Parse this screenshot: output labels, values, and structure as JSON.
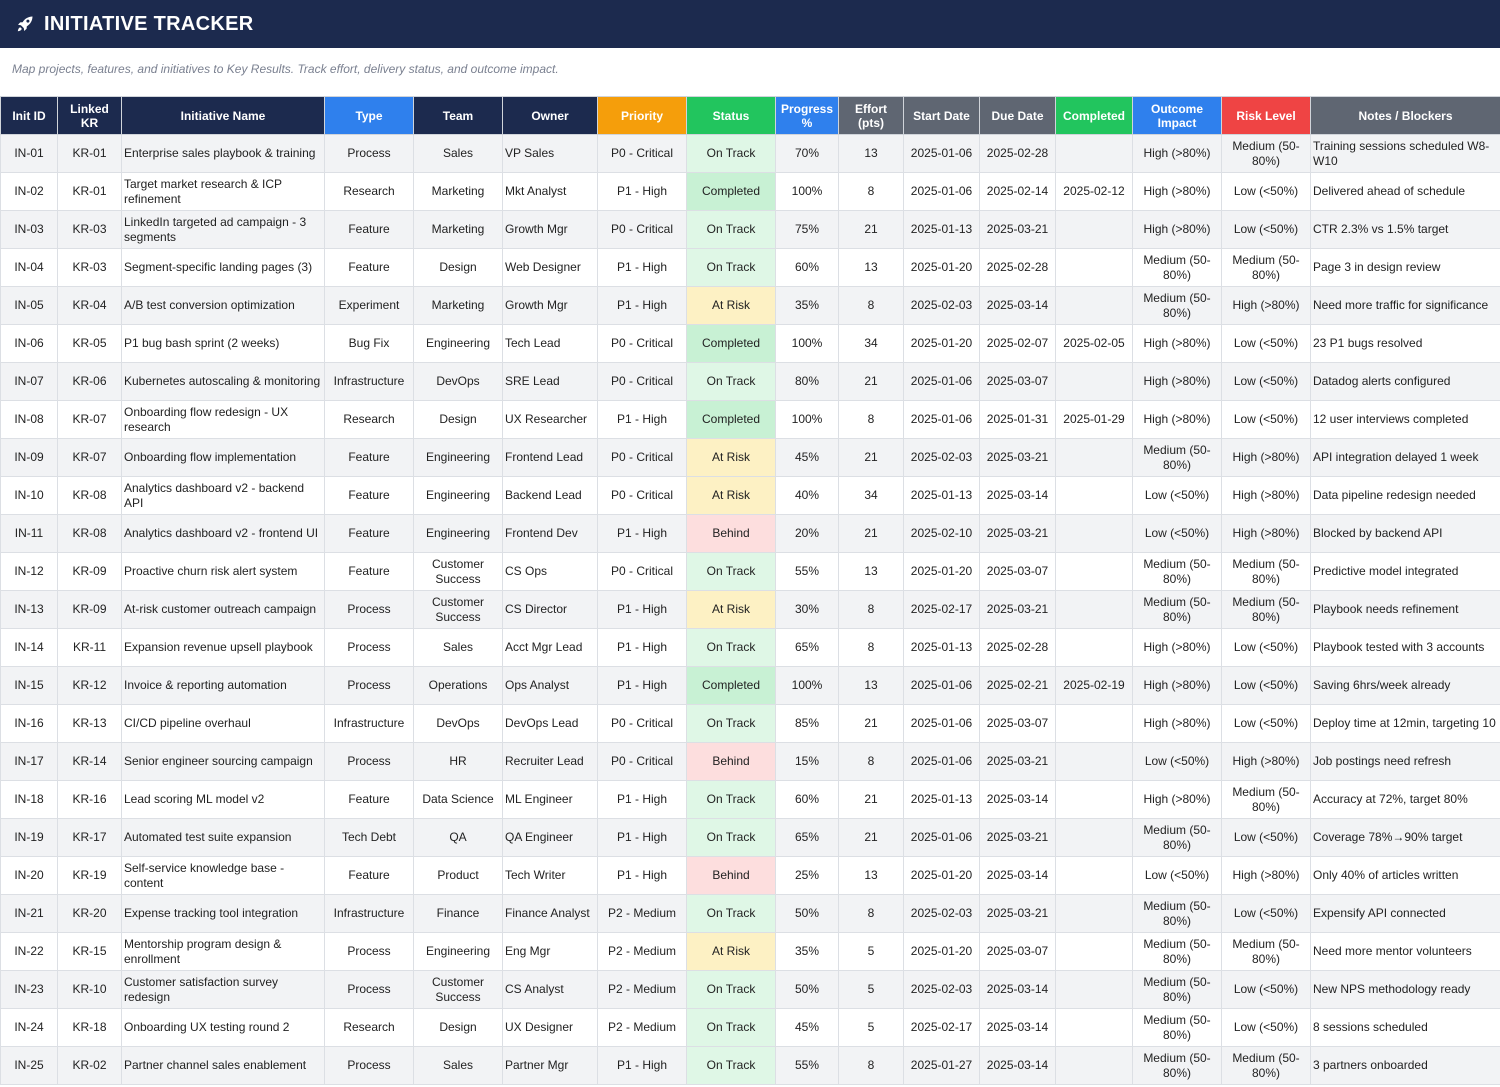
{
  "header": {
    "title": "INITIATIVE TRACKER",
    "icon": "rocket-icon",
    "subtitle": "Map projects, features, and initiatives to Key Results. Track effort, delivery status, and outcome impact."
  },
  "colors": {
    "title_bar": "#1c2a4e",
    "header_dark": "#1c2a4e",
    "header_type": "#2f80ed",
    "header_priority": "#f59e0b",
    "header_status": "#22c55e",
    "header_gray": "#5f6672",
    "header_completed": "#22c55e",
    "header_outcome": "#2f80ed",
    "header_risk": "#ef4444",
    "header_notes": "#5f6672",
    "status_on_track": "#dff7e6",
    "status_completed": "#c8f1d4",
    "status_at_risk": "#fdf1c4",
    "status_behind": "#fddede"
  },
  "columns": [
    {
      "label": "Init ID",
      "color": "#1c2a4e"
    },
    {
      "label": "Linked KR",
      "color": "#1c2a4e"
    },
    {
      "label": "Initiative Name",
      "color": "#1c2a4e"
    },
    {
      "label": "Type",
      "color": "#2f80ed"
    },
    {
      "label": "Team",
      "color": "#1c2a4e"
    },
    {
      "label": "Owner",
      "color": "#1c2a4e"
    },
    {
      "label": "Priority",
      "color": "#f59e0b"
    },
    {
      "label": "Status",
      "color": "#22c55e"
    },
    {
      "label": "Progress %",
      "color": "#2f80ed"
    },
    {
      "label": "Effort (pts)",
      "color": "#5f6672"
    },
    {
      "label": "Start Date",
      "color": "#5f6672"
    },
    {
      "label": "Due Date",
      "color": "#5f6672"
    },
    {
      "label": "Completed",
      "color": "#22c55e"
    },
    {
      "label": "Outcome Impact",
      "color": "#2f80ed"
    },
    {
      "label": "Risk Level",
      "color": "#ef4444"
    },
    {
      "label": "Notes / Blockers",
      "color": "#5f6672"
    }
  ],
  "rows": [
    [
      "IN-01",
      "KR-01",
      "Enterprise sales playbook & training",
      "Process",
      "Sales",
      "VP Sales",
      "P0 - Critical",
      "On Track",
      "70%",
      "13",
      "2025-01-06",
      "2025-02-28",
      "",
      "High (>80%)",
      "Medium (50-80%)",
      "Training sessions scheduled W8-W10"
    ],
    [
      "IN-02",
      "KR-01",
      "Target market research & ICP refinement",
      "Research",
      "Marketing",
      "Mkt Analyst",
      "P1 - High",
      "Completed",
      "100%",
      "8",
      "2025-01-06",
      "2025-02-14",
      "2025-02-12",
      "High (>80%)",
      "Low (<50%)",
      "Delivered ahead of schedule"
    ],
    [
      "IN-03",
      "KR-03",
      "LinkedIn targeted ad campaign - 3 segments",
      "Feature",
      "Marketing",
      "Growth Mgr",
      "P0 - Critical",
      "On Track",
      "75%",
      "21",
      "2025-01-13",
      "2025-03-21",
      "",
      "High (>80%)",
      "Low (<50%)",
      "CTR 2.3% vs 1.5% target"
    ],
    [
      "IN-04",
      "KR-03",
      "Segment-specific landing pages (3)",
      "Feature",
      "Design",
      "Web Designer",
      "P1 - High",
      "On Track",
      "60%",
      "13",
      "2025-01-20",
      "2025-02-28",
      "",
      "Medium (50-80%)",
      "Medium (50-80%)",
      "Page 3 in design review"
    ],
    [
      "IN-05",
      "KR-04",
      "A/B test conversion optimization",
      "Experiment",
      "Marketing",
      "Growth Mgr",
      "P1 - High",
      "At Risk",
      "35%",
      "8",
      "2025-02-03",
      "2025-03-14",
      "",
      "Medium (50-80%)",
      "High (>80%)",
      "Need more traffic for significance"
    ],
    [
      "IN-06",
      "KR-05",
      "P1 bug bash sprint (2 weeks)",
      "Bug Fix",
      "Engineering",
      "Tech Lead",
      "P0 - Critical",
      "Completed",
      "100%",
      "34",
      "2025-01-20",
      "2025-02-07",
      "2025-02-05",
      "High (>80%)",
      "Low (<50%)",
      "23 P1 bugs resolved"
    ],
    [
      "IN-07",
      "KR-06",
      "Kubernetes autoscaling & monitoring",
      "Infrastructure",
      "DevOps",
      "SRE Lead",
      "P0 - Critical",
      "On Track",
      "80%",
      "21",
      "2025-01-06",
      "2025-03-07",
      "",
      "High (>80%)",
      "Low (<50%)",
      "Datadog alerts configured"
    ],
    [
      "IN-08",
      "KR-07",
      "Onboarding flow redesign - UX research",
      "Research",
      "Design",
      "UX Researcher",
      "P1 - High",
      "Completed",
      "100%",
      "8",
      "2025-01-06",
      "2025-01-31",
      "2025-01-29",
      "High (>80%)",
      "Low (<50%)",
      "12 user interviews completed"
    ],
    [
      "IN-09",
      "KR-07",
      "Onboarding flow implementation",
      "Feature",
      "Engineering",
      "Frontend Lead",
      "P0 - Critical",
      "At Risk",
      "45%",
      "21",
      "2025-02-03",
      "2025-03-21",
      "",
      "Medium (50-80%)",
      "High (>80%)",
      "API integration delayed 1 week"
    ],
    [
      "IN-10",
      "KR-08",
      "Analytics dashboard v2 - backend API",
      "Feature",
      "Engineering",
      "Backend Lead",
      "P0 - Critical",
      "At Risk",
      "40%",
      "34",
      "2025-01-13",
      "2025-03-14",
      "",
      "Low (<50%)",
      "High (>80%)",
      "Data pipeline redesign needed"
    ],
    [
      "IN-11",
      "KR-08",
      "Analytics dashboard v2 - frontend UI",
      "Feature",
      "Engineering",
      "Frontend Dev",
      "P1 - High",
      "Behind",
      "20%",
      "21",
      "2025-02-10",
      "2025-03-21",
      "",
      "Low (<50%)",
      "High (>80%)",
      "Blocked by backend API"
    ],
    [
      "IN-12",
      "KR-09",
      "Proactive churn risk alert system",
      "Feature",
      "Customer Success",
      "CS Ops",
      "P0 - Critical",
      "On Track",
      "55%",
      "13",
      "2025-01-20",
      "2025-03-07",
      "",
      "Medium (50-80%)",
      "Medium (50-80%)",
      "Predictive model integrated"
    ],
    [
      "IN-13",
      "KR-09",
      "At-risk customer outreach campaign",
      "Process",
      "Customer Success",
      "CS Director",
      "P1 - High",
      "At Risk",
      "30%",
      "8",
      "2025-02-17",
      "2025-03-21",
      "",
      "Medium (50-80%)",
      "Medium (50-80%)",
      "Playbook needs refinement"
    ],
    [
      "IN-14",
      "KR-11",
      "Expansion revenue upsell playbook",
      "Process",
      "Sales",
      "Acct Mgr Lead",
      "P1 - High",
      "On Track",
      "65%",
      "8",
      "2025-01-13",
      "2025-02-28",
      "",
      "High (>80%)",
      "Low (<50%)",
      "Playbook tested with 3 accounts"
    ],
    [
      "IN-15",
      "KR-12",
      "Invoice & reporting automation",
      "Process",
      "Operations",
      "Ops Analyst",
      "P1 - High",
      "Completed",
      "100%",
      "13",
      "2025-01-06",
      "2025-02-21",
      "2025-02-19",
      "High (>80%)",
      "Low (<50%)",
      "Saving 6hrs/week already"
    ],
    [
      "IN-16",
      "KR-13",
      "CI/CD pipeline overhaul",
      "Infrastructure",
      "DevOps",
      "DevOps Lead",
      "P0 - Critical",
      "On Track",
      "85%",
      "21",
      "2025-01-06",
      "2025-03-07",
      "",
      "High (>80%)",
      "Low (<50%)",
      "Deploy time at 12min, targeting 10"
    ],
    [
      "IN-17",
      "KR-14",
      "Senior engineer sourcing campaign",
      "Process",
      "HR",
      "Recruiter Lead",
      "P0 - Critical",
      "Behind",
      "15%",
      "8",
      "2025-01-06",
      "2025-03-21",
      "",
      "Low (<50%)",
      "High (>80%)",
      "Job postings need refresh"
    ],
    [
      "IN-18",
      "KR-16",
      "Lead scoring ML model v2",
      "Feature",
      "Data Science",
      "ML Engineer",
      "P1 - High",
      "On Track",
      "60%",
      "21",
      "2025-01-13",
      "2025-03-14",
      "",
      "High (>80%)",
      "Medium (50-80%)",
      "Accuracy at 72%, target 80%"
    ],
    [
      "IN-19",
      "KR-17",
      "Automated test suite expansion",
      "Tech Debt",
      "QA",
      "QA Engineer",
      "P1 - High",
      "On Track",
      "65%",
      "21",
      "2025-01-06",
      "2025-03-21",
      "",
      "Medium (50-80%)",
      "Low (<50%)",
      "Coverage 78%→90% target"
    ],
    [
      "IN-20",
      "KR-19",
      "Self-service knowledge base - content",
      "Feature",
      "Product",
      "Tech Writer",
      "P1 - High",
      "Behind",
      "25%",
      "13",
      "2025-01-20",
      "2025-03-14",
      "",
      "Low (<50%)",
      "High (>80%)",
      "Only 40% of articles written"
    ],
    [
      "IN-21",
      "KR-20",
      "Expense tracking tool integration",
      "Infrastructure",
      "Finance",
      "Finance Analyst",
      "P2 - Medium",
      "On Track",
      "50%",
      "8",
      "2025-02-03",
      "2025-03-21",
      "",
      "Medium (50-80%)",
      "Low (<50%)",
      "Expensify API connected"
    ],
    [
      "IN-22",
      "KR-15",
      "Mentorship program design & enrollment",
      "Process",
      "Engineering",
      "Eng Mgr",
      "P2 - Medium",
      "At Risk",
      "35%",
      "5",
      "2025-01-20",
      "2025-03-07",
      "",
      "Medium (50-80%)",
      "Medium (50-80%)",
      "Need more mentor volunteers"
    ],
    [
      "IN-23",
      "KR-10",
      "Customer satisfaction survey redesign",
      "Process",
      "Customer Success",
      "CS Analyst",
      "P2 - Medium",
      "On Track",
      "50%",
      "5",
      "2025-02-03",
      "2025-03-14",
      "",
      "Medium (50-80%)",
      "Low (<50%)",
      "New NPS methodology ready"
    ],
    [
      "IN-24",
      "KR-18",
      "Onboarding UX testing round 2",
      "Research",
      "Design",
      "UX Designer",
      "P2 - Medium",
      "On Track",
      "45%",
      "5",
      "2025-02-17",
      "2025-03-14",
      "",
      "Medium (50-80%)",
      "Low (<50%)",
      "8 sessions scheduled"
    ],
    [
      "IN-25",
      "KR-02",
      "Partner channel sales enablement",
      "Process",
      "Sales",
      "Partner Mgr",
      "P1 - High",
      "On Track",
      "55%",
      "8",
      "2025-01-27",
      "2025-03-14",
      "",
      "Medium (50-80%)",
      "Medium (50-80%)",
      "3 partners onboarded"
    ]
  ]
}
